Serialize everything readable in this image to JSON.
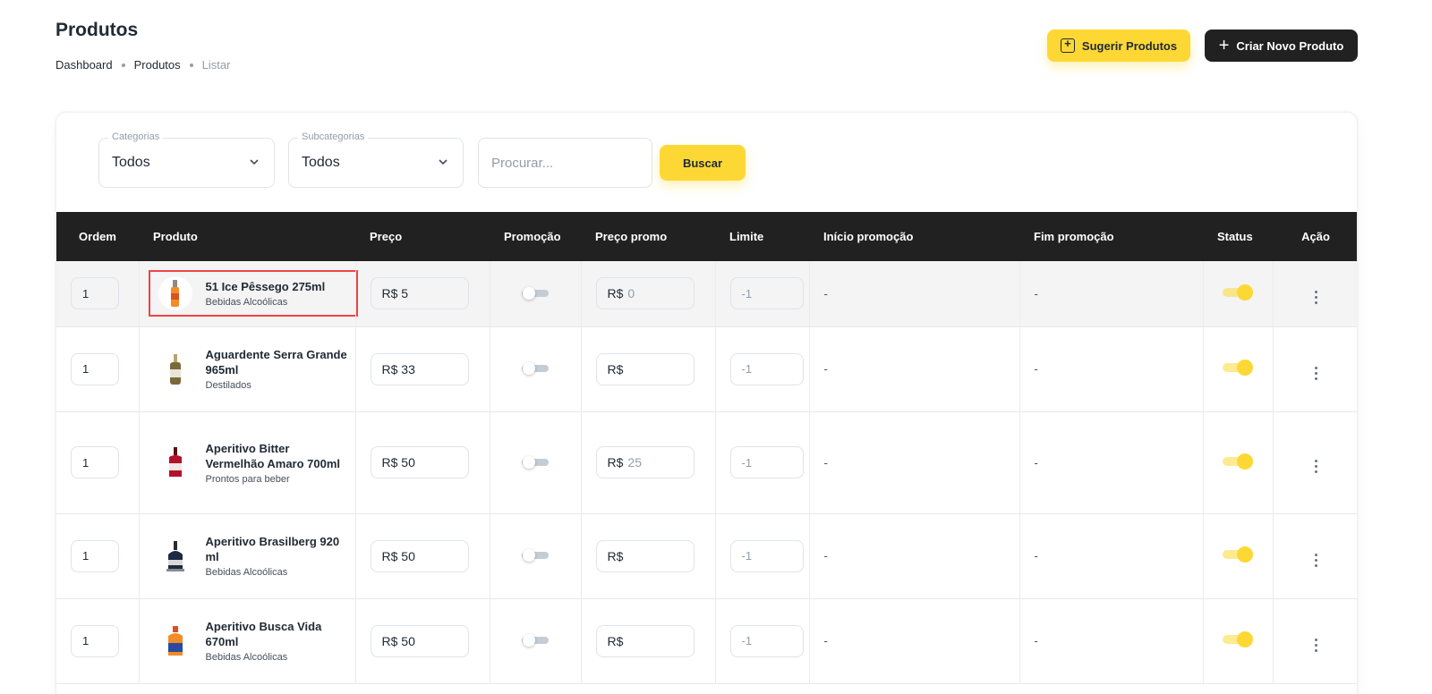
{
  "header": {
    "title": "Produtos",
    "breadcrumb": [
      "Dashboard",
      "Produtos",
      "Listar"
    ],
    "suggest_button": "Sugerir Produtos",
    "create_button": "Criar Novo Produto"
  },
  "filters": {
    "category": {
      "legend": "Categorias",
      "value": "Todos"
    },
    "subcategory": {
      "legend": "Subcategorias",
      "value": "Todos"
    },
    "search_placeholder": "Procurar...",
    "search_button": "Buscar"
  },
  "table": {
    "columns": [
      "Ordem",
      "Produto",
      "Preço",
      "Promoção",
      "Preço promo",
      "Limite",
      "Início promoção",
      "Fim promoção",
      "Status",
      "Ação"
    ],
    "rows": [
      {
        "order": "1",
        "name": "51 Ice Pêssego 275ml",
        "category": "Bebidas Alcoólicas",
        "currency": "R$",
        "price": "5",
        "promo_price": "0",
        "limit": "-1",
        "promo_start": "-",
        "promo_end": "-",
        "promo_on": false,
        "status_on": true
      },
      {
        "order": "1",
        "name": "Aguardente Serra Grande 965ml",
        "category": "Destilados",
        "currency": "R$",
        "price": "33",
        "promo_price": "",
        "limit": "-1",
        "promo_start": "-",
        "promo_end": "-",
        "promo_on": false,
        "status_on": true
      },
      {
        "order": "1",
        "name": "Aperitivo Bitter Vermelhão Amaro 700ml",
        "category": "Prontos para beber",
        "currency": "R$",
        "price": "50",
        "promo_price": "25",
        "limit": "-1",
        "promo_start": "-",
        "promo_end": "-",
        "promo_on": false,
        "status_on": true
      },
      {
        "order": "1",
        "name": "Aperitivo Brasilberg 920 ml",
        "category": "Bebidas Alcoólicas",
        "currency": "R$",
        "price": "50",
        "promo_price": "",
        "limit": "-1",
        "promo_start": "-",
        "promo_end": "-",
        "promo_on": false,
        "status_on": true
      },
      {
        "order": "1",
        "name": "Aperitivo Busca Vida 670ml",
        "category": "Bebidas Alcoólicas",
        "currency": "R$",
        "price": "50",
        "promo_price": "",
        "limit": "-1",
        "promo_start": "-",
        "promo_end": "-",
        "promo_on": false,
        "status_on": true
      }
    ]
  },
  "colors": {
    "accent": "#fdd835",
    "dark": "#212121",
    "highlight_border": "#ef4444"
  },
  "icons": {
    "suggest": "plus-square-icon",
    "create": "plus-icon",
    "select": "chevron-down-icon",
    "action": "more-vertical-icon"
  }
}
